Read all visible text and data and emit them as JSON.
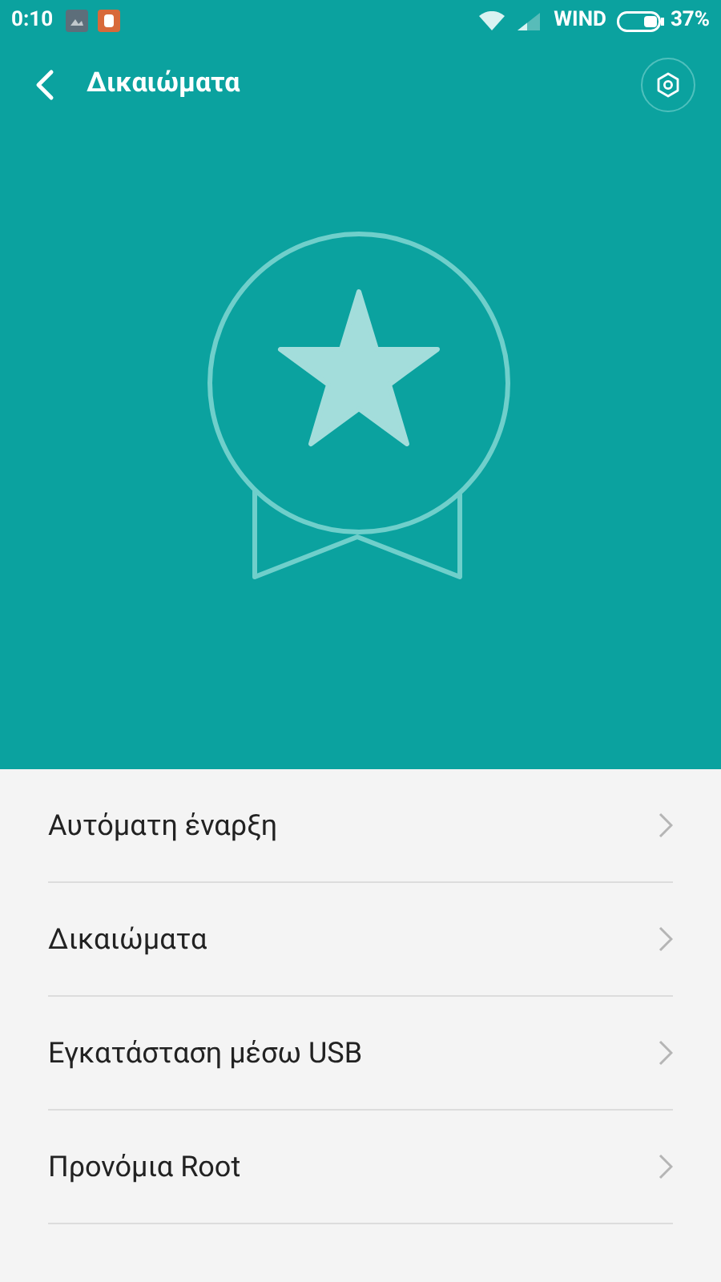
{
  "status_bar": {
    "time": "0:10",
    "carrier": "WIND",
    "battery": "37%"
  },
  "header": {
    "title": "Δικαιώματα"
  },
  "items": [
    {
      "label": "Αυτόματη έναρξη"
    },
    {
      "label": "Δικαιώματα"
    },
    {
      "label": "Εγκατάσταση μέσω USB"
    },
    {
      "label": "Προνόμια Root"
    }
  ]
}
